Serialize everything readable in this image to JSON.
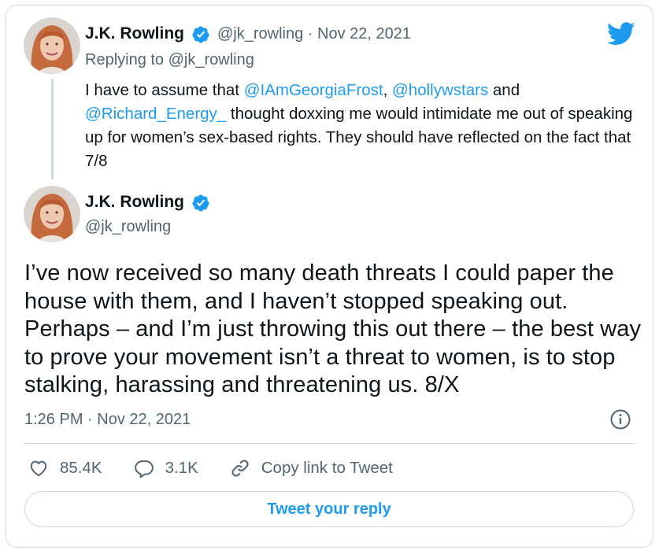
{
  "parent_tweet": {
    "author_name": "J.K. Rowling",
    "handle": "@jk_rowling",
    "separator": "·",
    "date": "Nov 22, 2021",
    "replying_prefix": "Replying to ",
    "replying_to": "@jk_rowling",
    "text_part1": "I have to assume that ",
    "mention1": "@IAmGeorgiaFrost",
    "text_part2": ", ",
    "mention2": "@hollywstars",
    "text_part3": " and ",
    "mention3": "@Richard_Energy_",
    "text_part4": " thought doxxing me would intimidate me out of speaking up for women’s sex-based rights. They should have reflected on the fact that 7/8"
  },
  "main_tweet": {
    "author_name": "J.K. Rowling",
    "handle": "@jk_rowling",
    "text": "I’ve now received so many death threats I could paper the house with them, and I haven’t stopped speaking out. Perhaps – and I’m just throwing this out there – the best way to prove your movement isn’t a threat to women, is to stop stalking, harassing and threatening us. 8/X",
    "timestamp": "1:26 PM · Nov 22, 2021"
  },
  "actions": {
    "likes": "85.4K",
    "replies": "3.1K",
    "copy_link": "Copy link to Tweet"
  },
  "reply_button": "Tweet your reply",
  "icons": {
    "brand": "twitter-bird-icon",
    "verified": "verified-badge-icon",
    "info": "info-icon",
    "like": "heart-icon",
    "reply": "speech-bubble-icon",
    "link": "link-icon"
  },
  "colors": {
    "accent": "#1d9bf0",
    "secondary_text": "#536471",
    "border": "#cfd9de"
  }
}
